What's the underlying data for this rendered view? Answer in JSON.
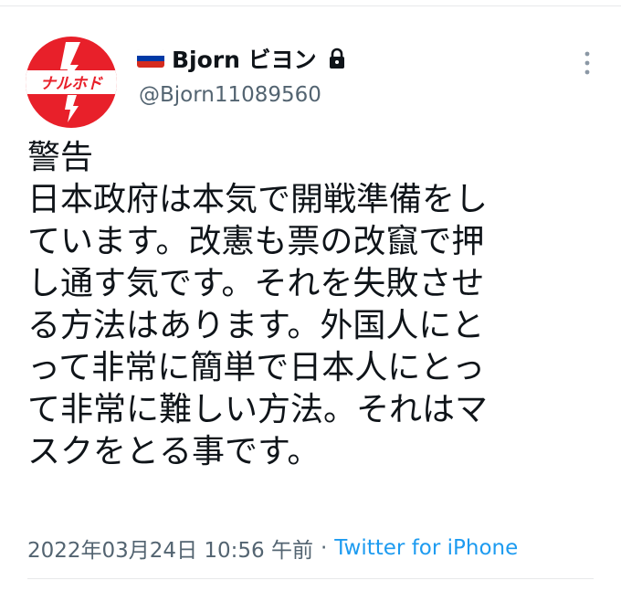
{
  "user": {
    "avatar_text": "ナルホド",
    "flag_icon": "russia-flag-icon",
    "flag_colors": [
      "#ffffff",
      "#0039a6",
      "#d52b1e"
    ],
    "display_name": "Bjorn ビヨン",
    "protected_icon": "lock-icon",
    "handle": "@Bjorn11089560"
  },
  "tweet": {
    "lines": [
      "警告",
      "日本政府は本気で開戦準備をし",
      "ています。改憲も票の改竄で押",
      "し通す気です。それを失敗させ",
      "る方法はあります。外国人にと",
      "って非常に簡単で日本人にとっ",
      "て非常に難しい方法。それはマ",
      "スクをとる事です。"
    ]
  },
  "meta": {
    "timestamp": "2022年03月24日 10:56 午前",
    "separator": "·",
    "source": "Twitter for iPhone"
  },
  "colors": {
    "avatar_red": "#e8202a",
    "link_blue": "#1d9bf0",
    "secondary_text": "#536471"
  },
  "more_icon": "more-vertical-icon"
}
